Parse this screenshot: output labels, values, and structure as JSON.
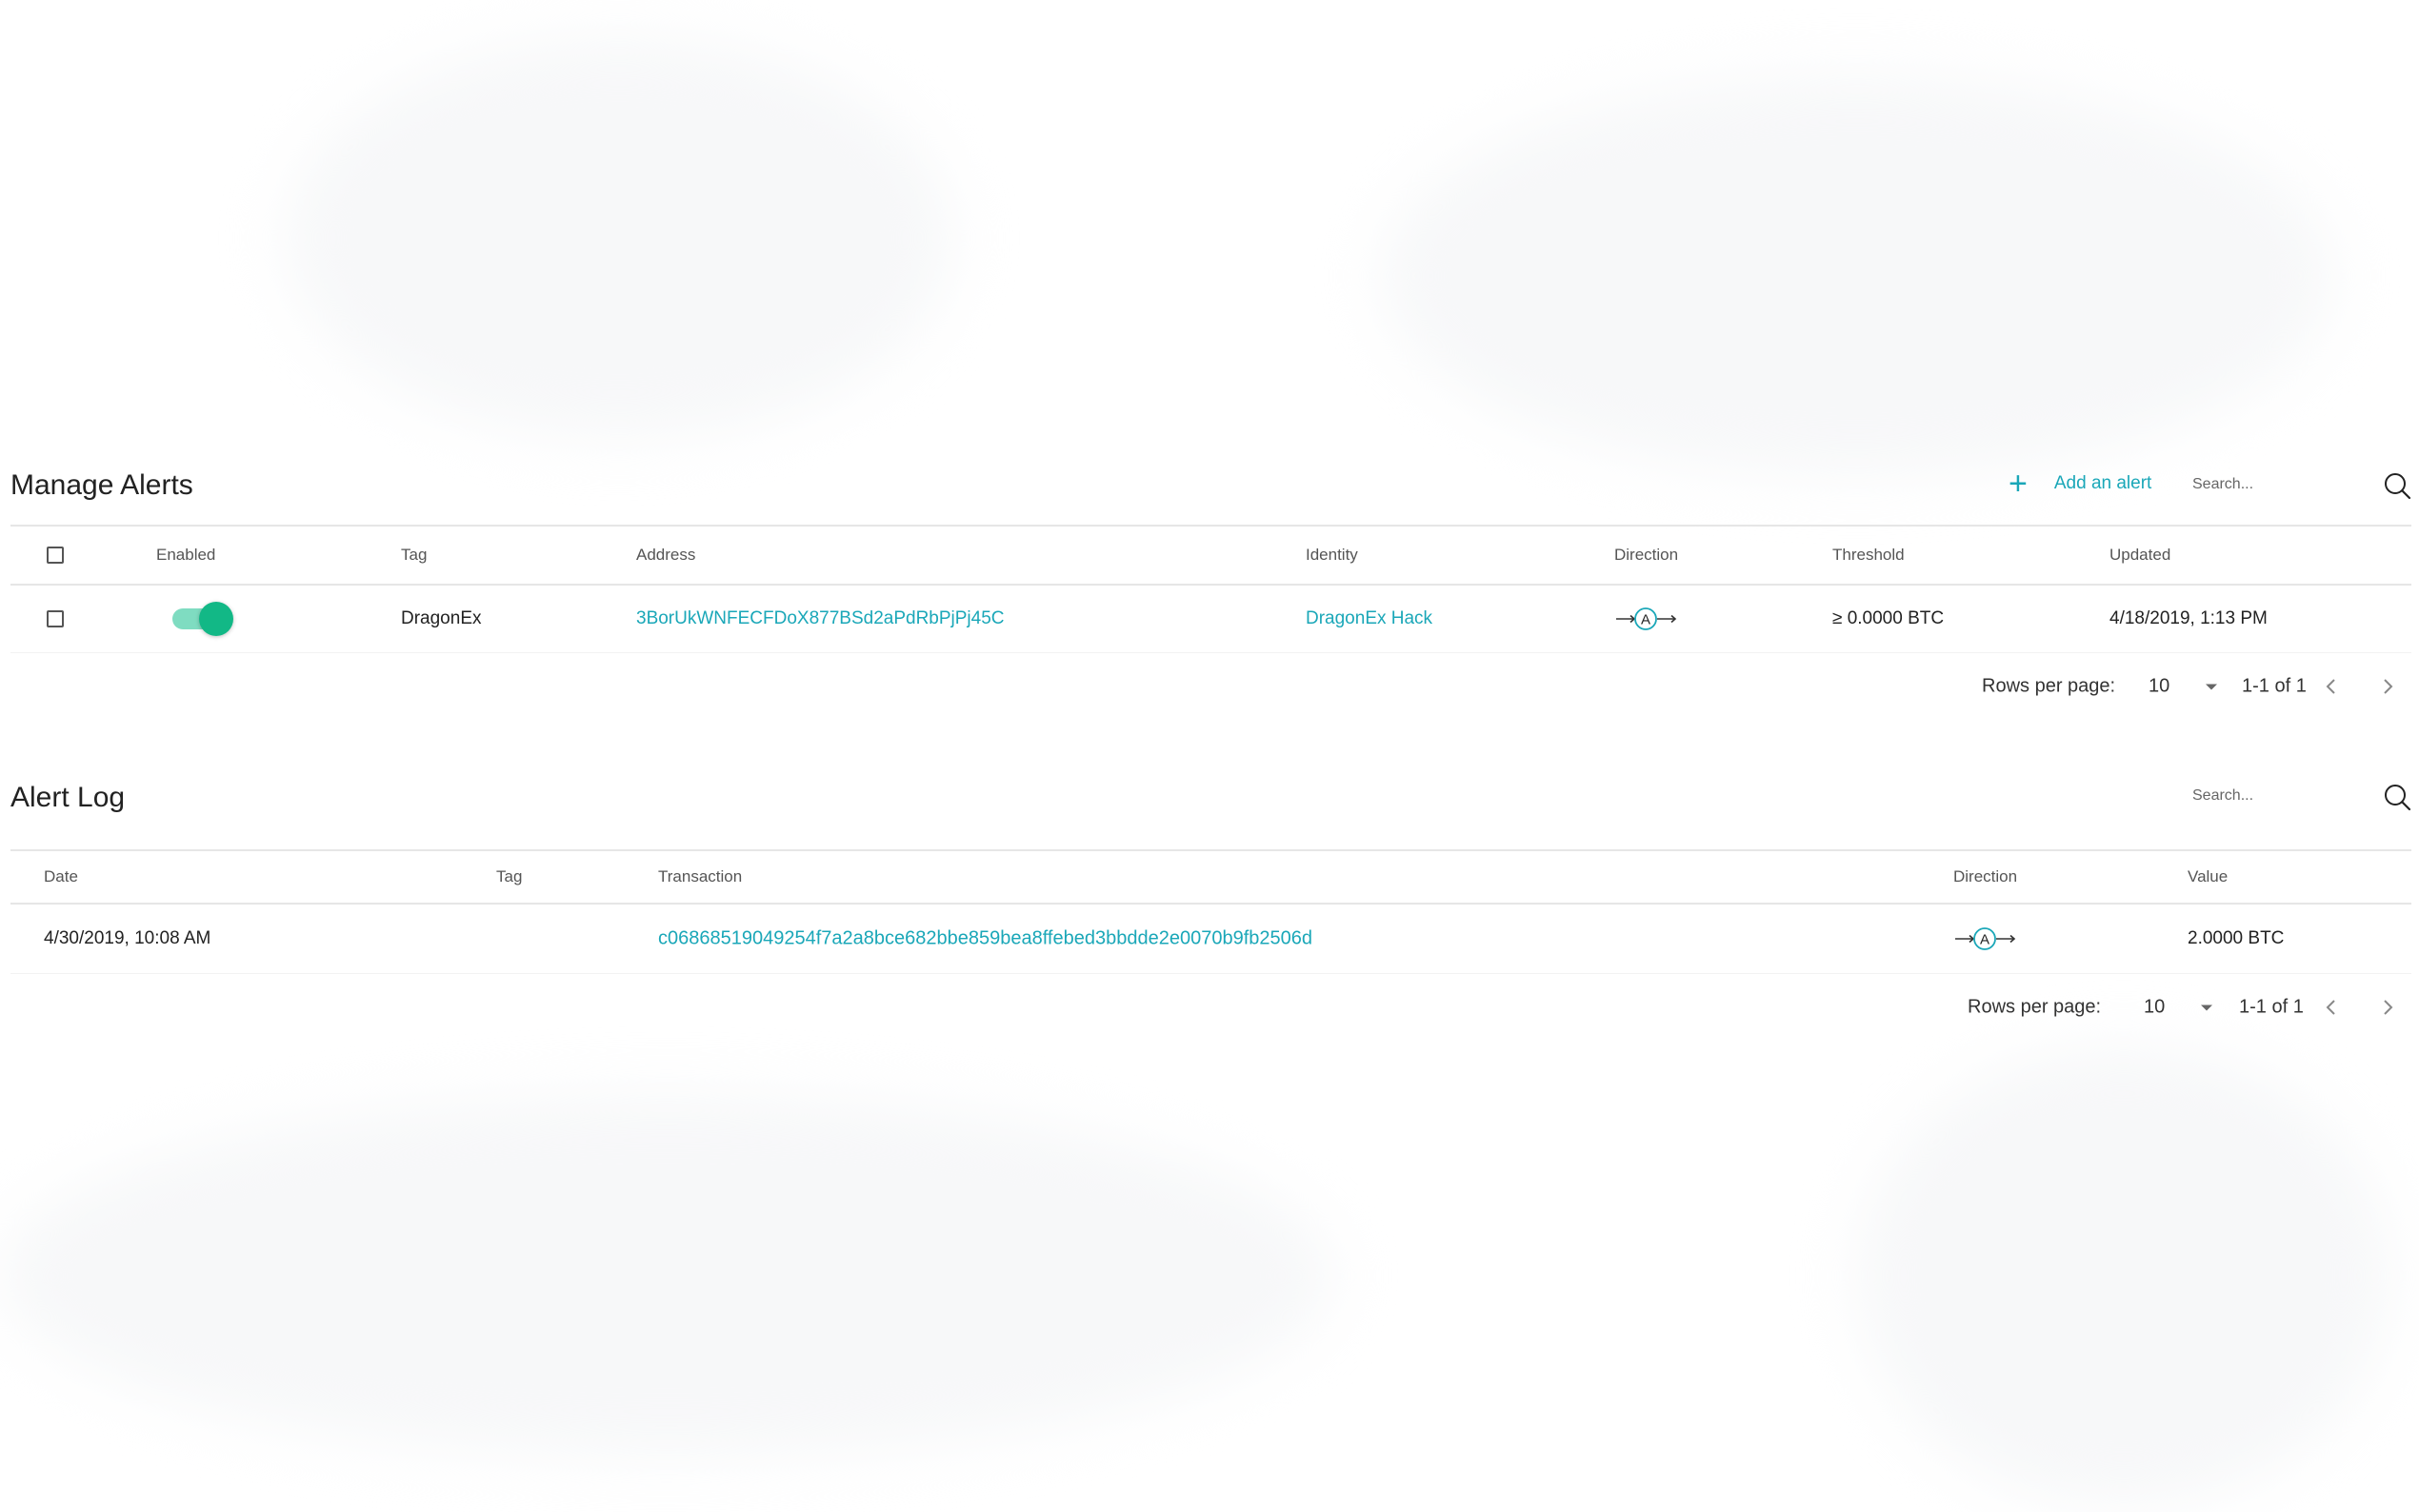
{
  "colors": {
    "accent": "#1aa7b8",
    "toggle_on": "#12b886",
    "toggle_track": "#7fdcc1",
    "border": "#e6e6e6"
  },
  "manage_alerts": {
    "title": "Manage Alerts",
    "add_label": "Add an alert",
    "search_placeholder": "Search...",
    "columns": {
      "enabled": "Enabled",
      "tag": "Tag",
      "address": "Address",
      "identity": "Identity",
      "direction": "Direction",
      "threshold": "Threshold",
      "updated": "Updated"
    },
    "rows": [
      {
        "enabled": true,
        "tag": "DragonEx",
        "address": "3BorUkWNFECFDoX877BSd2aPdRbPjPj45C",
        "identity": "DragonEx Hack",
        "direction": "A",
        "threshold": "≥ 0.0000 BTC",
        "updated": "4/18/2019, 1:13 PM"
      }
    ],
    "pagination": {
      "rows_label": "Rows per page:",
      "rows_value": "10",
      "range": "1-1 of 1"
    }
  },
  "alert_log": {
    "title": "Alert Log",
    "search_placeholder": "Search...",
    "columns": {
      "date": "Date",
      "tag": "Tag",
      "transaction": "Transaction",
      "direction": "Direction",
      "value": "Value"
    },
    "rows": [
      {
        "date": "4/30/2019, 10:08 AM",
        "tag": "",
        "transaction": "c06868519049254f7a2a8bce682bbe859bea8ffebed3bbdde2e0070b9fb2506d",
        "direction": "A",
        "value": "2.0000 BTC"
      }
    ],
    "pagination": {
      "rows_label": "Rows per page:",
      "rows_value": "10",
      "range": "1-1 of 1"
    }
  }
}
